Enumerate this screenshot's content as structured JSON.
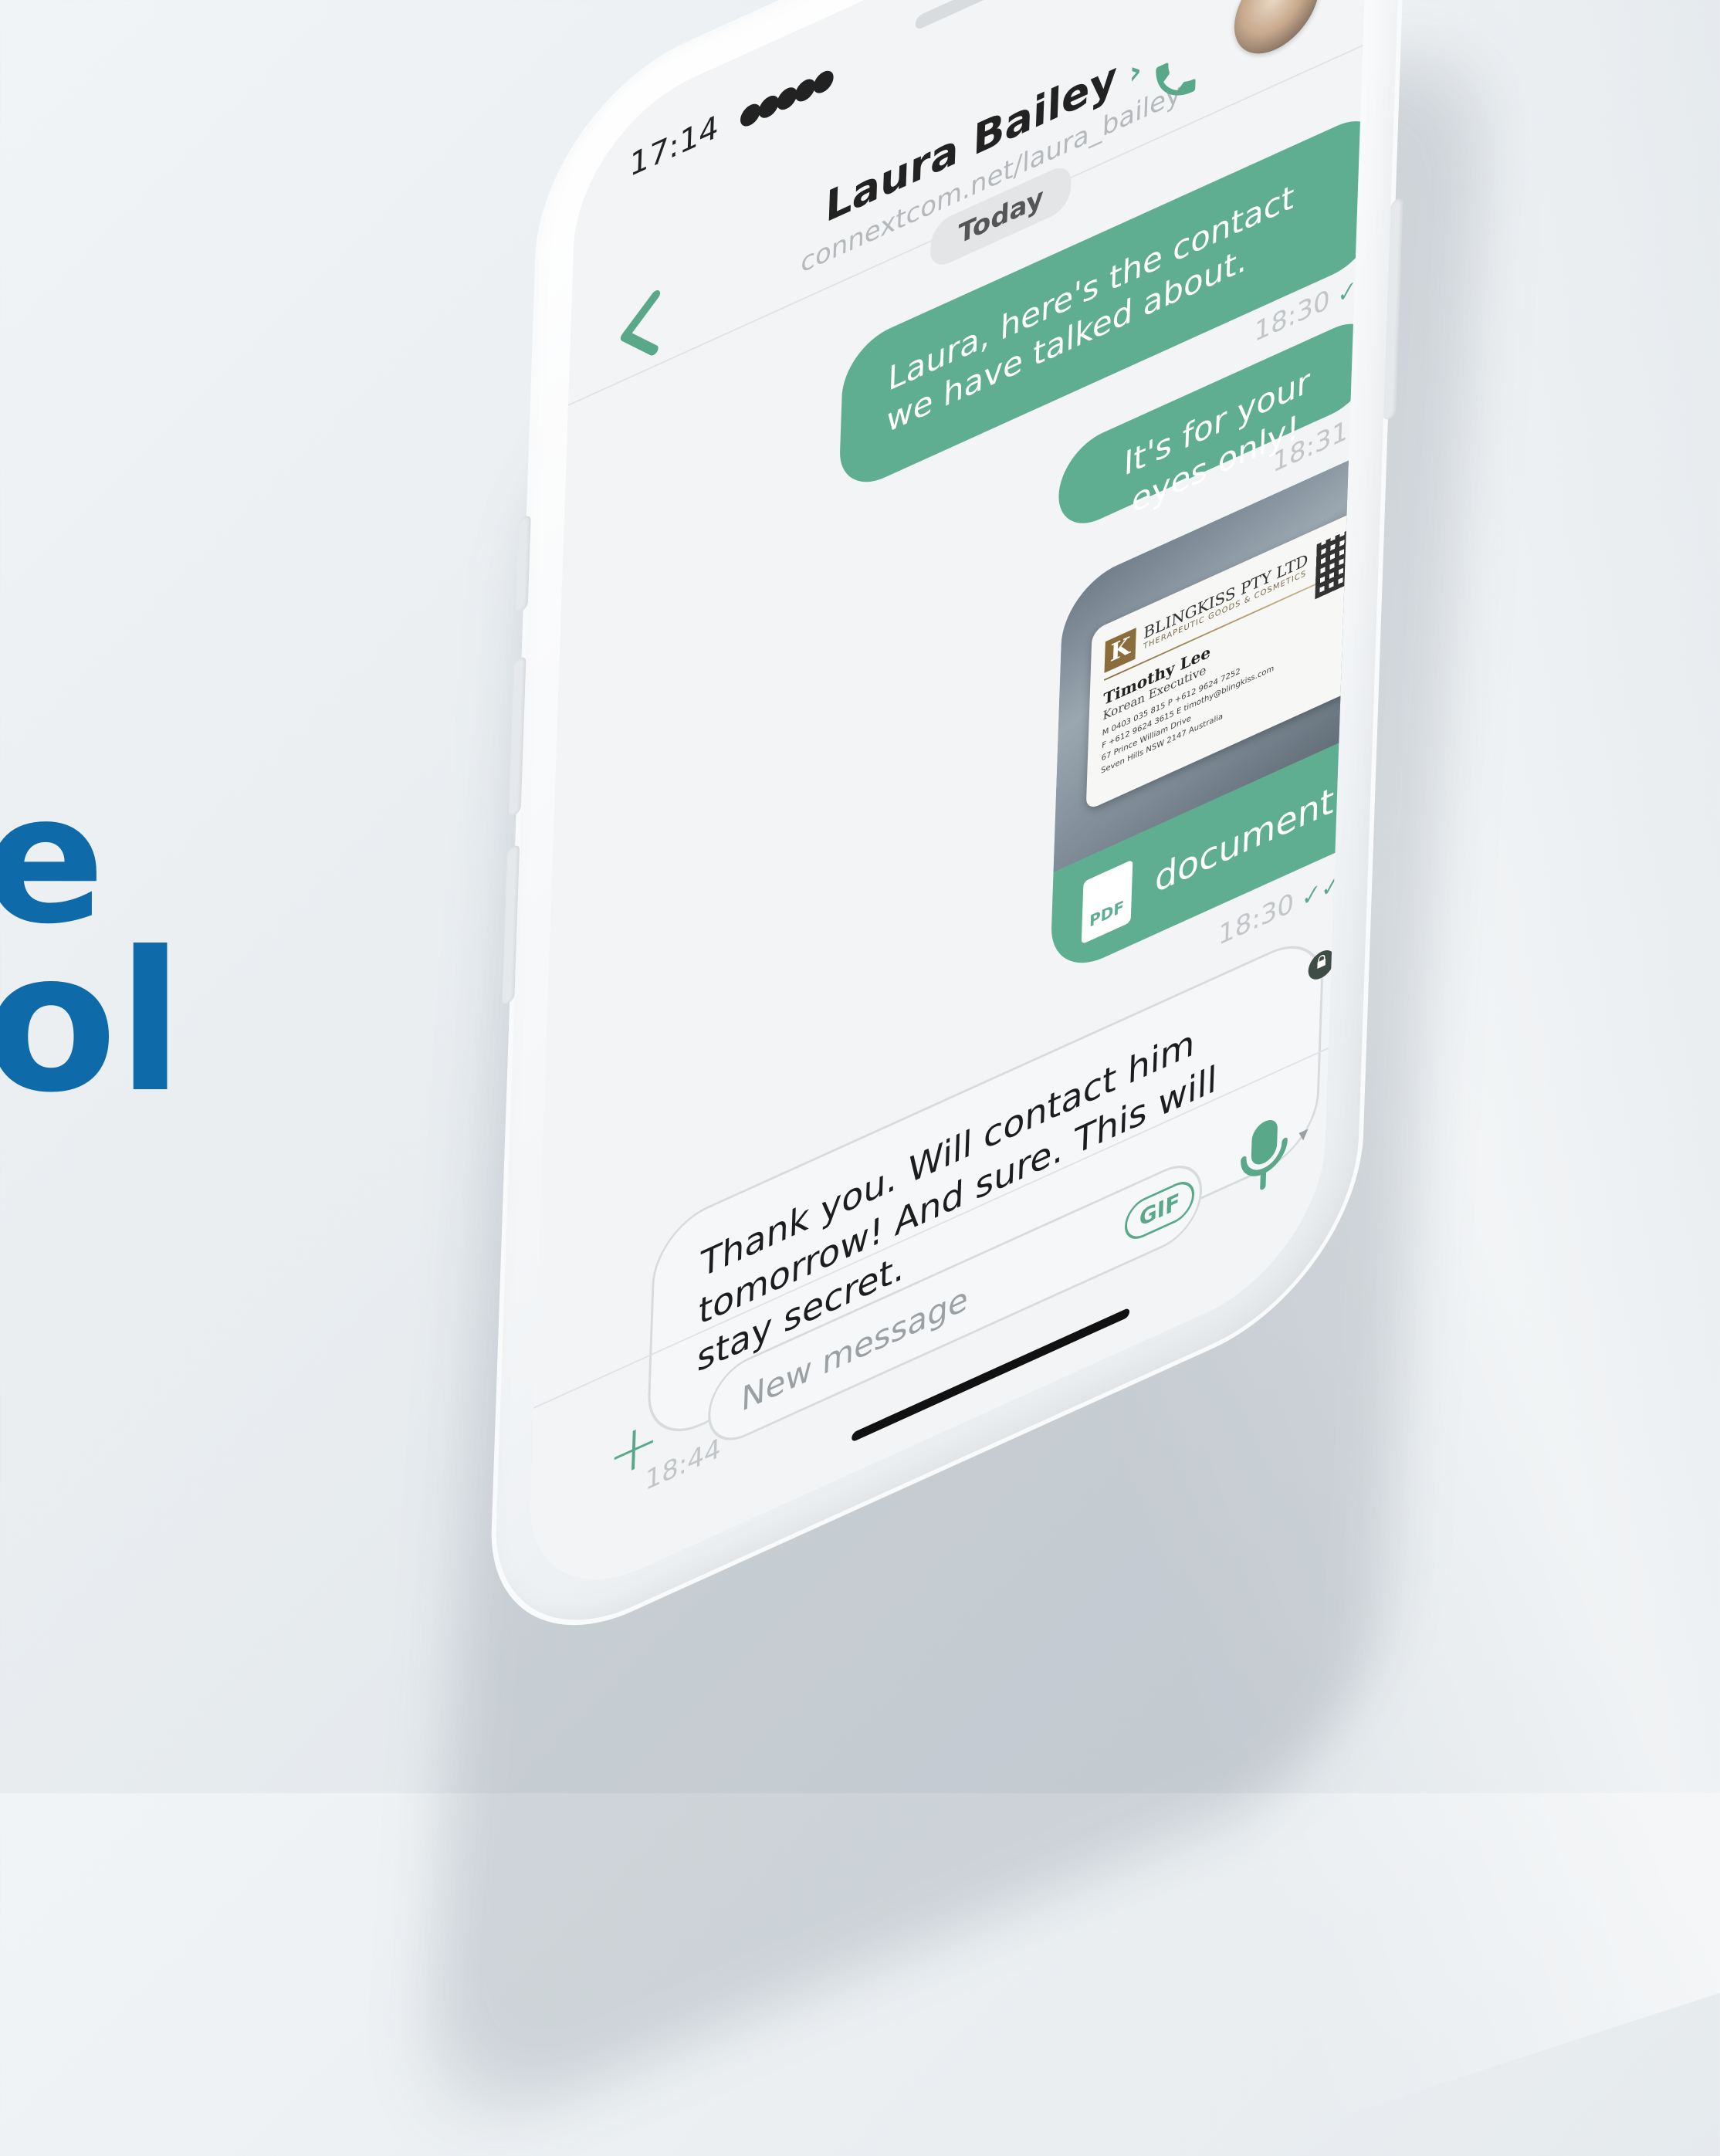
{
  "headline": {
    "line1": "e",
    "line2": "ol"
  },
  "status_bar": {
    "time": "17:14",
    "signal": "●●●●●"
  },
  "header": {
    "back_icon": "chevron-left-icon",
    "contact_name": "Laura Bailey",
    "contact_chevron": "›",
    "contact_url": "connextcom.net/laura_bailey",
    "call_icon": "phone-icon",
    "avatar_badge": "((•))"
  },
  "day_separator": "Today",
  "messages": [
    {
      "direction": "out",
      "text": "Laura, here's the contact we have talked about.",
      "time": "18:30",
      "tick": "✓✓"
    },
    {
      "direction": "out",
      "text": "It's for your eyes only!",
      "time": "18:31",
      "tick": "✓✓"
    },
    {
      "direction": "out",
      "type": "file",
      "file_name": "document.pdf",
      "file_icon": "PDF",
      "time": "18:30",
      "tick": "✓✓"
    },
    {
      "direction": "in",
      "text": "Thank you. Will contact him tomorrow! And sure. This will stay secret.",
      "time": "18:44"
    }
  ],
  "business_card": {
    "logo_letter": "K",
    "company": "BLINGKISS PTY LTD",
    "tagline": "THERAPEUTIC GOODS & COSMETICS",
    "name": "Timothy Lee",
    "title": "Korean Executive",
    "line1": "M 0403 035 815  P +612 9624 7252",
    "line2": "F +612 9624 3615  E timothy@blingkiss.com",
    "line3": "67 Prince William Drive",
    "line4": "Seven Hills NSW 2147 Australia"
  },
  "composer": {
    "add_label": "+",
    "placeholder": "New message",
    "gif_label": "GIF",
    "mic_caret": "▾"
  },
  "colors": {
    "accent": "#5fae91",
    "headline": "#0e6aa8"
  }
}
